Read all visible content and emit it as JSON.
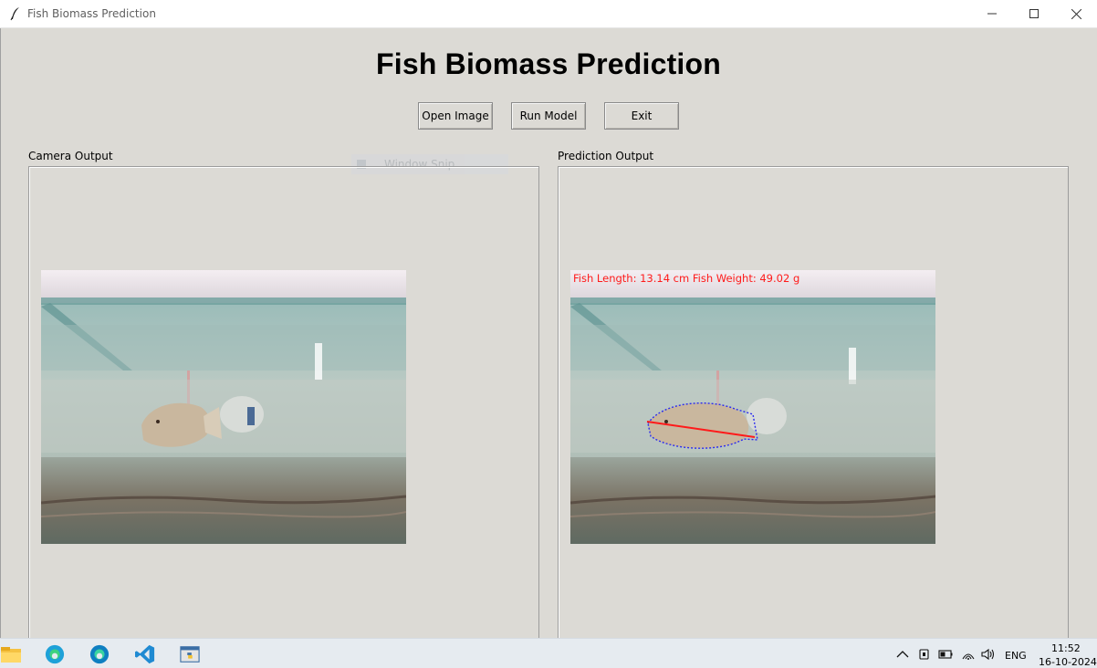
{
  "window": {
    "title": "Fish Biomass Prediction"
  },
  "app": {
    "heading": "Fish Biomass Prediction",
    "buttons": {
      "open_image": "Open Image",
      "run_model": "Run Model",
      "exit": "Exit"
    },
    "panels": {
      "camera_label": "Camera Output",
      "prediction_label": "Prediction Output"
    },
    "prediction_overlay": "Fish Length: 13.14 cm Fish Weight: 49.02 g",
    "ghost_window_snip": "Window Snip"
  },
  "taskbar": {
    "apps": [
      "file-explorer-icon",
      "edge-icon",
      "edge-beta-icon",
      "vscode-icon",
      "python-idle-icon"
    ],
    "tray": {
      "language": "ENG",
      "time": "11:52",
      "date": "16-10-2024"
    }
  },
  "colors": {
    "window_bg": "#dcdad5",
    "overlay_text": "#ff1a1a",
    "length_line": "#ff1a1a",
    "contour": "#2a2af0"
  }
}
